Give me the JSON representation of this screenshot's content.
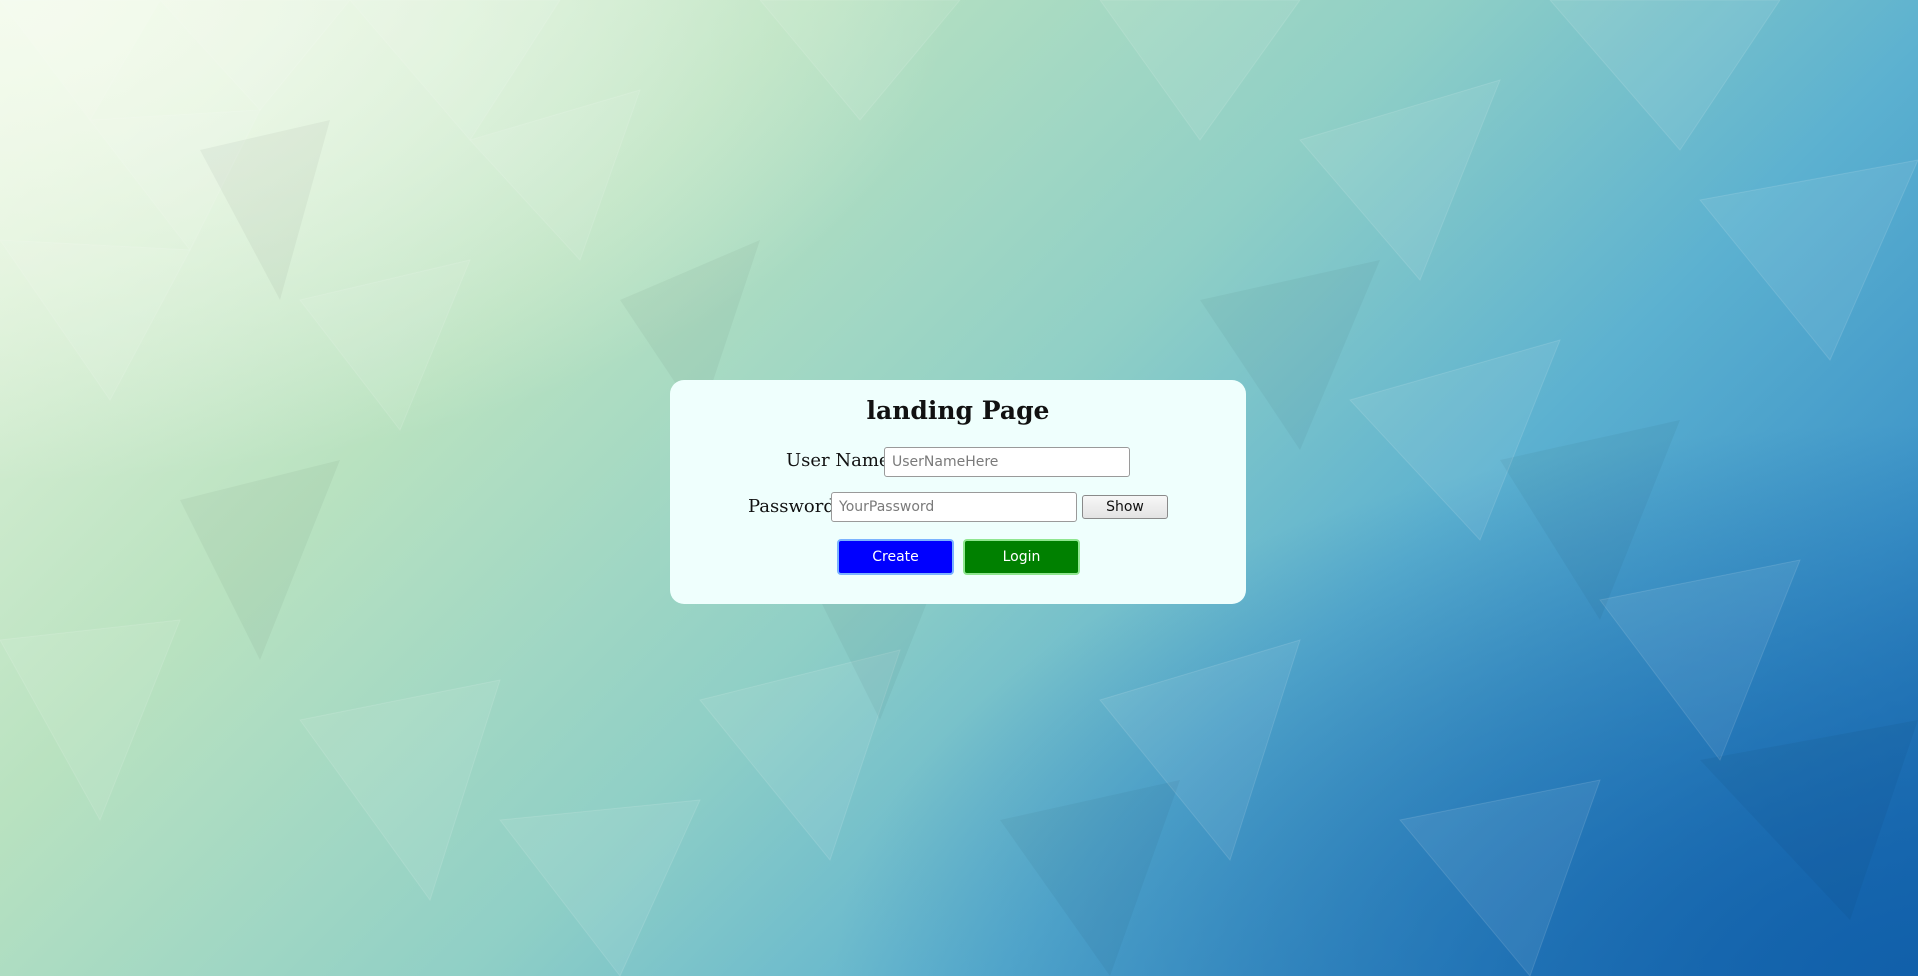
{
  "page": {
    "title": "landing Page"
  },
  "form": {
    "username_label": "User Name",
    "username_placeholder": "UserNameHere",
    "username_value": "",
    "password_label": "Password",
    "password_placeholder": "YourPassword",
    "password_value": "",
    "show_label": "Show",
    "create_label": "Create",
    "login_label": "Login"
  },
  "colors": {
    "card_background": "#effffd",
    "create_button": "#0000ff",
    "login_button": "#008000"
  }
}
